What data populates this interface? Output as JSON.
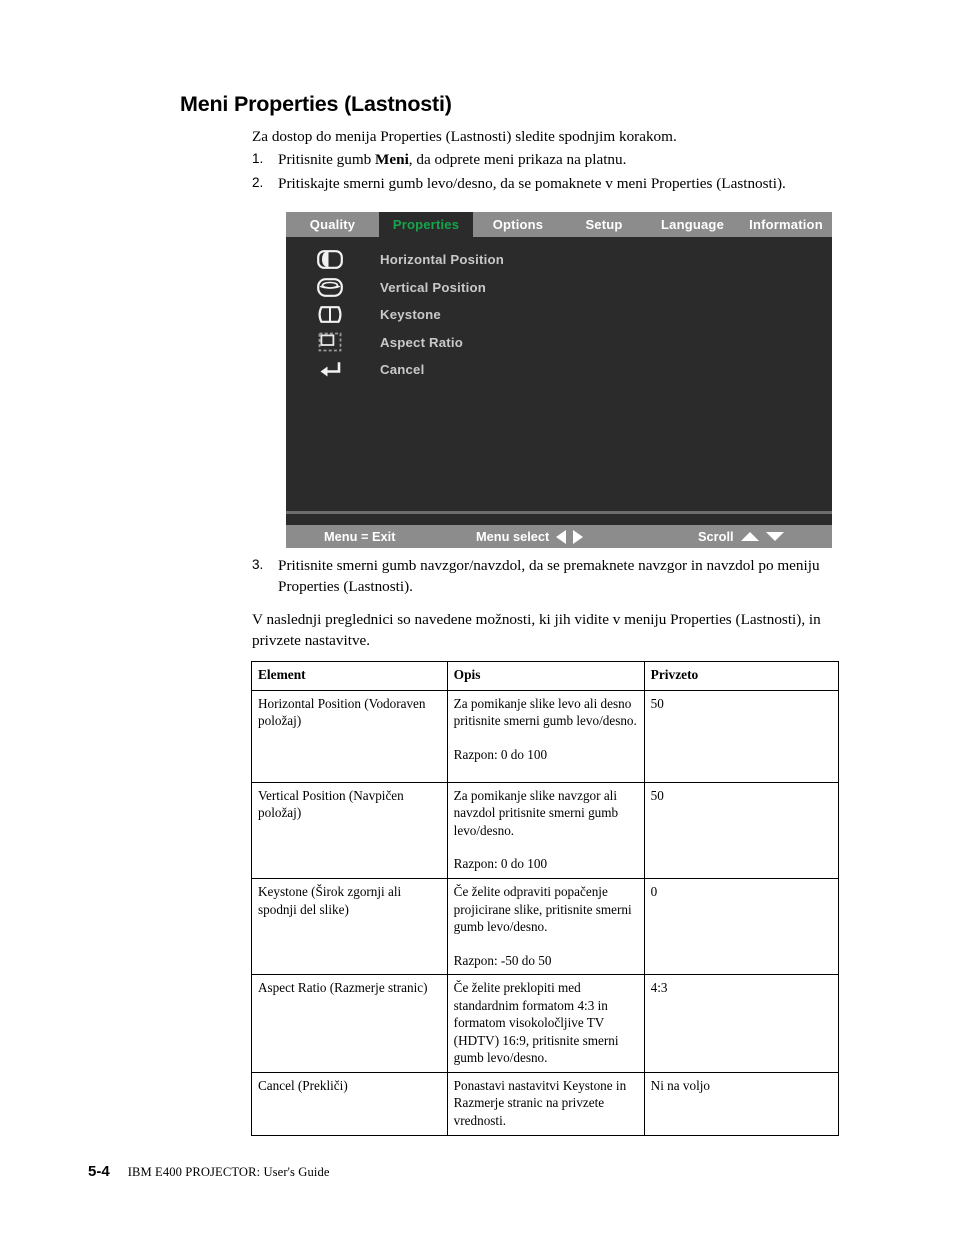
{
  "page": {
    "title": "Meni Properties (Lastnosti)",
    "intro": "Za dostop do menija Properties (Lastnosti) sledite spodnjim korakom.",
    "steps": [
      {
        "num": "1.",
        "text_before": "Pritisnite gumb ",
        "bold": "Meni",
        "text_after": ", da odprete meni prikaza na platnu."
      },
      {
        "num": "2.",
        "text": "Pritiskajte smerni gumb levo/desno, da se pomaknete v meni Properties (Lastnosti)."
      },
      {
        "num": "3.",
        "text": "Pritisnite smerni gumb navzgor/navzdol, da se premaknete navzgor in navzdol po meniju Properties (Lastnosti)."
      }
    ],
    "paragraph_after_steps": "V naslednji preglednici so navedene možnosti, ki jih vidite v meniju Properties (Lastnosti), in privzete nastavitve."
  },
  "osd": {
    "tabs": [
      {
        "label": "Quality",
        "active": false
      },
      {
        "label": "Properties",
        "active": true
      },
      {
        "label": "Options",
        "active": false
      },
      {
        "label": "Setup",
        "active": false
      },
      {
        "label": "Language",
        "active": false
      },
      {
        "label": "Information",
        "active": false
      }
    ],
    "items": [
      {
        "icon": "horizontal-position-icon",
        "label": "Horizontal Position"
      },
      {
        "icon": "vertical-position-icon",
        "label": "Vertical Position"
      },
      {
        "icon": "keystone-icon",
        "label": "Keystone"
      },
      {
        "icon": "aspect-ratio-icon",
        "label": "Aspect Ratio"
      },
      {
        "icon": "return-arrow-icon",
        "label": "Cancel"
      }
    ],
    "footer": {
      "exit": "Menu = Exit",
      "select": "Menu select",
      "scroll": "Scroll"
    },
    "colors": {
      "bar": "#8c8c8c",
      "background": "#2b2b2b",
      "active_tab_text": "#15a54a",
      "item_text": "#c9c9c9",
      "bar_text": "#ffffff"
    }
  },
  "table": {
    "headers": [
      "Element",
      "Opis",
      "Privzeto"
    ],
    "rows": [
      {
        "element": "Horizontal Position (Vodoraven položaj)",
        "opis_main": "Za pomikanje slike levo ali desno pritisnite smerni gumb levo/desno.",
        "opis_range": "Razpon: 0 do 100",
        "privzeto": "50"
      },
      {
        "element": "Vertical Position (Navpičen položaj)",
        "opis_main": "Za pomikanje slike navzgor ali navzdol pritisnite smerni gumb levo/desno.",
        "opis_range": "Razpon: 0 do 100",
        "privzeto": "50"
      },
      {
        "element": "Keystone (Širok zgornji ali spodnji del slike)",
        "opis_main": "Če želite odpraviti popačenje projicirane slike, pritisnite smerni gumb levo/desno.",
        "opis_range": "Razpon: -50 do 50",
        "privzeto": "0"
      },
      {
        "element": "Aspect Ratio (Razmerje stranic)",
        "opis_main": "Če želite preklopiti med standardnim formatom 4:3 in formatom visokoločljive TV (HDTV) 16:9, pritisnite smerni gumb levo/desno.",
        "opis_range": "",
        "privzeto": "4:3"
      },
      {
        "element": "Cancel (Prekliči)",
        "opis_main": "Ponastavi nastavitvi Keystone in Razmerje stranic na privzete vrednosti.",
        "opis_range": "",
        "privzeto": "Ni na voljo"
      }
    ]
  },
  "footer": {
    "page_number": "5-4",
    "document_title": "IBM E400 PROJECTOR: User's Guide"
  }
}
